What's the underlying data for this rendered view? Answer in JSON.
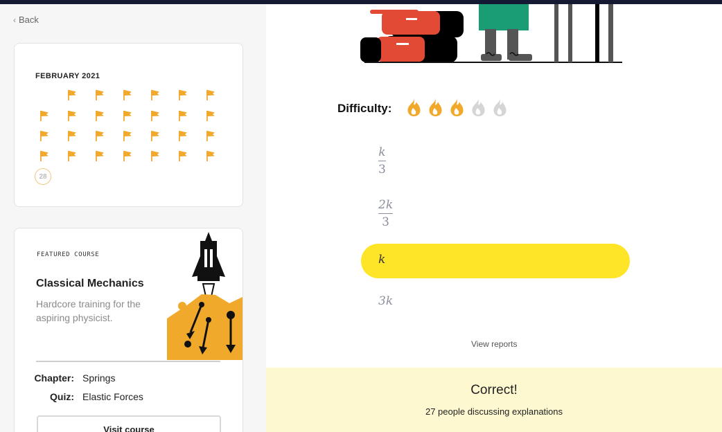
{
  "nav": {
    "back_label": "Back"
  },
  "calendar": {
    "month_title": "FEBRUARY 2021",
    "completed_days": 27,
    "current_day": "28",
    "flag_color": "#f0a92b"
  },
  "featured": {
    "label": "FEATURED  COURSE",
    "title": "Classical Mechanics",
    "description": "Hardcore training for the aspiring physicist.",
    "chapter_key": "Chapter:",
    "chapter_val": "Springs",
    "quiz_key": "Quiz:",
    "quiz_val": "Elastic Forces",
    "visit_label": "Visit course"
  },
  "problem": {
    "difficulty_label": "Difficulty:",
    "difficulty_level": 3,
    "difficulty_max": 5,
    "options": [
      {
        "num": "k",
        "den": "3",
        "selected": false
      },
      {
        "num": "2k",
        "den": "3",
        "selected": false
      },
      {
        "text": "k",
        "selected": true
      },
      {
        "text": "3k",
        "selected": false
      }
    ],
    "view_reports": "View reports"
  },
  "result": {
    "title": "Correct!",
    "subtitle": "27 people discussing explanations"
  },
  "colors": {
    "accent_yellow": "#ffe528",
    "flame_active": "#f0a92b",
    "flame_inactive": "#d5d5d5",
    "panel_bg": "#fdf8d0"
  }
}
